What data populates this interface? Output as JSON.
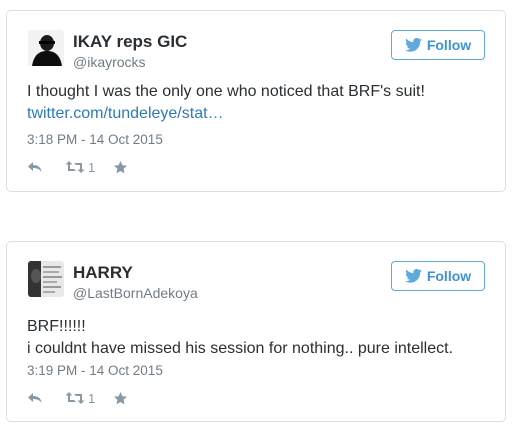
{
  "tweets": [
    {
      "name": "IKAY reps GIC",
      "handle": "@ikayrocks",
      "follow_label": "Follow",
      "text_line1": "I thought I was the only one who noticed that BRF's suit!",
      "link": "twitter.com/tundeleye/stat…",
      "timestamp": "3:18 PM - 14 Oct 2015",
      "retweet_count": "1",
      "avatar_icon": "user-avatar-icon"
    },
    {
      "name": "HARRY",
      "handle": "@LastBornAdekoya",
      "follow_label": "Follow",
      "text_line1": "BRF!!!!!!",
      "text_line2": "i couldnt have missed his session for nothing.. pure intellect.",
      "timestamp": "3:19 PM - 14 Oct 2015",
      "retweet_count": "1",
      "avatar_icon": "user-avatar-icon"
    }
  ],
  "colors": {
    "twitter_blue": "#3b94d9",
    "link_blue": "#2b7bb9",
    "text": "#292f33",
    "muted": "#707d87",
    "border": "#dcdfe3"
  }
}
